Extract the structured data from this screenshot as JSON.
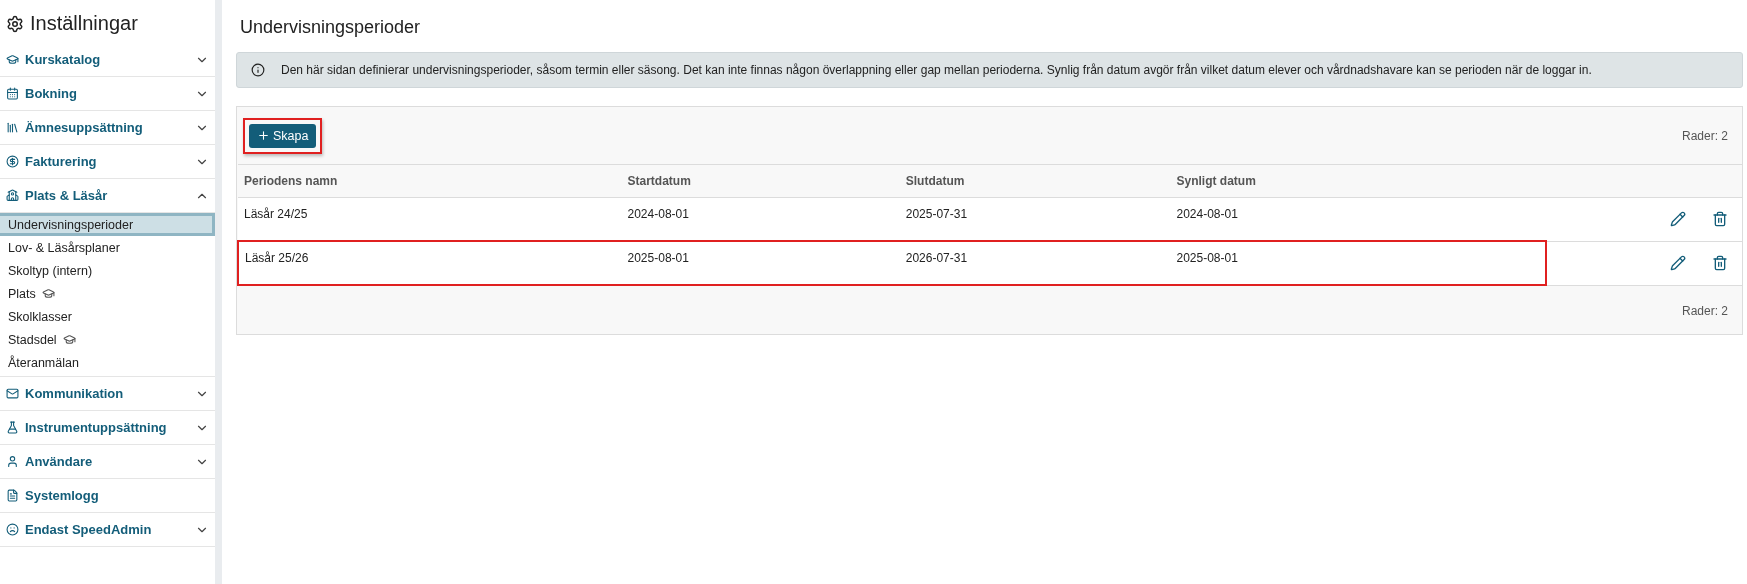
{
  "sidebar": {
    "title": "Inställningar",
    "sections": [
      {
        "label": "Kurskatalog",
        "kind": "group",
        "expanded": false
      },
      {
        "label": "Bokning",
        "kind": "group",
        "expanded": false
      },
      {
        "label": "Ämnesuppsättning",
        "kind": "group",
        "expanded": false
      },
      {
        "label": "Fakturering",
        "kind": "group",
        "expanded": false
      },
      {
        "label": "Plats & Läsår",
        "kind": "group",
        "expanded": true,
        "items": [
          {
            "label": "Undervisningsperioder",
            "selected": true,
            "cap": false
          },
          {
            "label": "Lov- & Läsårsplaner",
            "selected": false,
            "cap": false
          },
          {
            "label": "Skoltyp (intern)",
            "selected": false,
            "cap": false
          },
          {
            "label": "Plats",
            "selected": false,
            "cap": true
          },
          {
            "label": "Skolklasser",
            "selected": false,
            "cap": false
          },
          {
            "label": "Stadsdel",
            "selected": false,
            "cap": true
          },
          {
            "label": "Återanmälan",
            "selected": false,
            "cap": false
          }
        ]
      },
      {
        "label": "Kommunikation",
        "kind": "group",
        "expanded": false
      },
      {
        "label": "Instrumentuppsättning",
        "kind": "group",
        "expanded": false
      },
      {
        "label": "Användare",
        "kind": "group",
        "expanded": false
      },
      {
        "label": "Systemlogg",
        "kind": "link"
      },
      {
        "label": "Endast SpeedAdmin",
        "kind": "group",
        "expanded": false
      }
    ]
  },
  "page": {
    "title": "Undervisningsperioder",
    "info": "Den här sidan definierar undervisningsperioder, såsom termin eller säsong. Det kan inte finnas någon överlappning eller gap mellan perioderna. Synlig från datum avgör från vilket datum elever och vårdnadshavare kan se perioden när de loggar in.",
    "create_button": {
      "label": "Skapa",
      "highlighted": true
    },
    "row_count_top": "Rader: 2",
    "table": {
      "columns": [
        "Periodens namn",
        "Startdatum",
        "Slutdatum",
        "Synligt datum"
      ],
      "rows": [
        {
          "cells": [
            "Läsår 24/25",
            "2024-08-01",
            "2025-07-31",
            "2024-08-01"
          ],
          "highlighted": false
        },
        {
          "cells": [
            "Läsår 25/26",
            "2025-08-01",
            "2026-07-31",
            "2025-08-01"
          ],
          "highlighted": true
        }
      ]
    },
    "row_count_bottom": "Rader: 2"
  }
}
